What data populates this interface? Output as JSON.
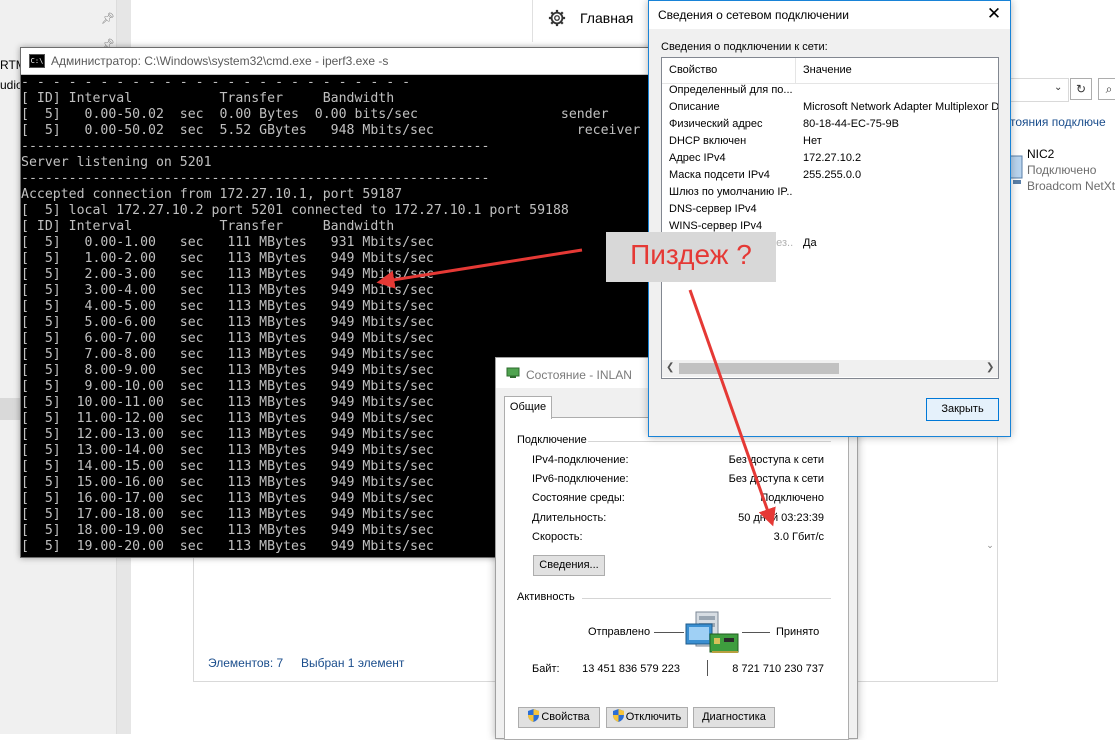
{
  "explorer": {
    "left_fragments": [
      "RTM",
      "udio"
    ],
    "home_label": "Главная",
    "connections_link": "тояния подключе",
    "nic": {
      "name": "NIC2",
      "status": "Подключено",
      "desc": "Broadcom NetXt"
    },
    "status_items": "Элементов: 7",
    "status_selected": "Выбран 1 элемент"
  },
  "cmd": {
    "title": "Администратор: C:\\Windows\\system32\\cmd.exe - iperf3.exe  -s",
    "icon_label": "C:\\",
    "lines": [
      "- - - - - - - - - - - - - - - - - - - - - - - - -",
      "[ ID] Interval           Transfer     Bandwidth",
      "[  5]   0.00-50.02  sec  0.00 Bytes  0.00 bits/sec                  sender",
      "[  5]   0.00-50.02  sec  5.52 GBytes   948 Mbits/sec                  receiver",
      "-----------------------------------------------------------",
      "Server listening on 5201",
      "-----------------------------------------------------------",
      "Accepted connection from 172.27.10.1, port 59187",
      "[  5] local 172.27.10.2 port 5201 connected to 172.27.10.1 port 59188",
      "[ ID] Interval           Transfer     Bandwidth",
      "[  5]   0.00-1.00   sec   111 MBytes   931 Mbits/sec",
      "[  5]   1.00-2.00   sec   113 MBytes   949 Mbits/sec",
      "[  5]   2.00-3.00   sec   113 MBytes   949 Mbits/sec",
      "[  5]   3.00-4.00   sec   113 MBytes   949 Mbits/sec",
      "[  5]   4.00-5.00   sec   113 MBytes   949 Mbits/sec",
      "[  5]   5.00-6.00   sec   113 MBytes   949 Mbits/sec",
      "[  5]   6.00-7.00   sec   113 MBytes   949 Mbits/sec",
      "[  5]   7.00-8.00   sec   113 MBytes   949 Mbits/sec",
      "[  5]   8.00-9.00   sec   113 MBytes   949 Mbits/sec",
      "[  5]   9.00-10.00  sec   113 MBytes   949 Mbits/sec",
      "[  5]  10.00-11.00  sec   113 MBytes   949 Mbits/sec",
      "[  5]  11.00-12.00  sec   113 MBytes   949 Mbits/sec",
      "[  5]  12.00-13.00  sec   113 MBytes   949 Mbits/sec",
      "[  5]  13.00-14.00  sec   113 MBytes   949 Mbits/sec",
      "[  5]  14.00-15.00  sec   113 MBytes   949 Mbits/sec",
      "[  5]  15.00-16.00  sec   113 MBytes   949 Mbits/sec",
      "[  5]  16.00-17.00  sec   113 MBytes   949 Mbits/sec",
      "[  5]  17.00-18.00  sec   113 MBytes   949 Mbits/sec",
      "[  5]  18.00-19.00  sec   113 MBytes   949 Mbits/sec",
      "[  5]  19.00-20.00  sec   113 MBytes   949 Mbits/sec"
    ]
  },
  "state": {
    "title": "Состояние - INLAN",
    "tab": "Общие",
    "connection_heading": "Подключение",
    "rows": [
      {
        "label": "IPv4-подключение:",
        "value": "Без доступа к сети"
      },
      {
        "label": "IPv6-подключение:",
        "value": "Без доступа к сети"
      },
      {
        "label": "Состояние среды:",
        "value": "Подключено"
      },
      {
        "label": "Длительность:",
        "value": "50 дней 03:23:39"
      },
      {
        "label": "Скорость:",
        "value": "3.0 Гбит/с"
      }
    ],
    "details_button": "Сведения...",
    "activity_heading": "Активность",
    "sent_label": "Отправлено",
    "received_label": "Принято",
    "bytes_label": "Байт:",
    "bytes_sent": "13 451 836 579 223",
    "bytes_received": "8 721 710 230 737",
    "buttons": {
      "properties": "Свойства",
      "disable": "Отключить",
      "diagnose": "Диагностика"
    }
  },
  "details": {
    "title": "Сведения о сетевом подключении",
    "heading": "Сведения о подключении к сети:",
    "col_property": "Свойство",
    "col_value": "Значение",
    "rows": [
      {
        "p": "Определенный для по...",
        "v": ""
      },
      {
        "p": "Описание",
        "v": "Microsoft Network Adapter Multiplexor Dri"
      },
      {
        "p": "Физический адрес",
        "v": "80-18-44-EC-75-9B"
      },
      {
        "p": "DHCP включен",
        "v": "Нет"
      },
      {
        "p": "Адрес IPv4",
        "v": "172.27.10.2"
      },
      {
        "p": "Маска подсети IPv4",
        "v": "255.255.0.0"
      },
      {
        "p": "Шлюз по умолчанию IP...",
        "v": ""
      },
      {
        "p": "DNS-сервер IPv4",
        "v": ""
      },
      {
        "p": "WINS-сервер IPv4",
        "v": ""
      },
      {
        "p": "Служба NetBIOS через...",
        "v": "Да"
      }
    ],
    "close_button": "Закрыть"
  },
  "annotation": {
    "text": "Пиздеж ?",
    "color": "#e53935"
  }
}
